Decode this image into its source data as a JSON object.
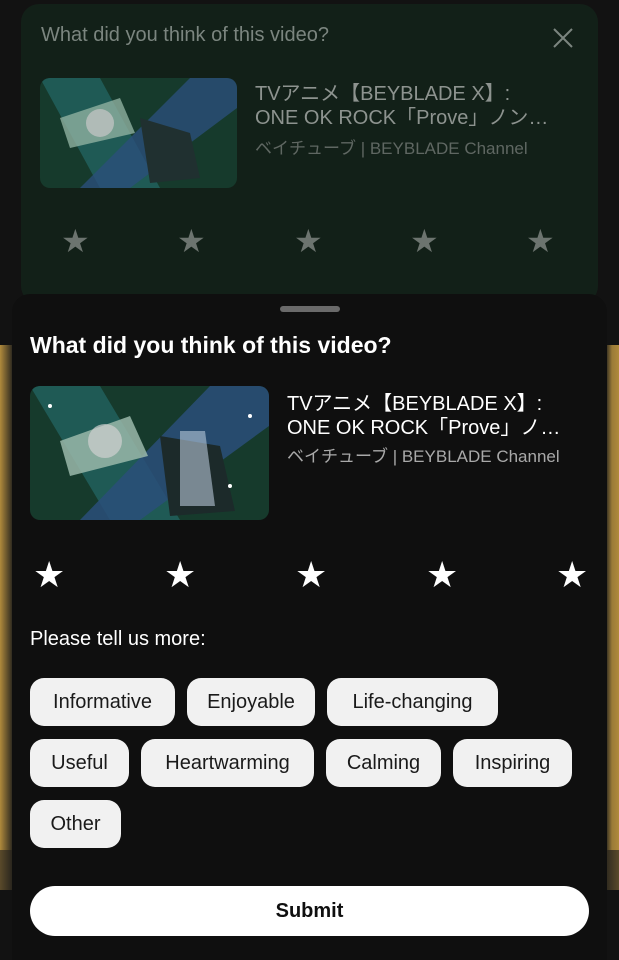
{
  "colors": {
    "background": "#121212",
    "sheet": "#0f0f0f",
    "chip_bg": "#f1f1f1",
    "text_primary": "#ffffff",
    "text_secondary": "#a9a9a9"
  },
  "back_card": {
    "title": "What did you think of this video?",
    "close_icon": "close-icon",
    "video_title_line1": "TVアニメ【BEYBLADE X】:",
    "video_title_line2": "ONE OK ROCK「Prove」ノン…",
    "channel": "ベイチューブ | BEYBLADE Channel"
  },
  "sheet": {
    "title": "What did you think of this video?",
    "video_title_line1": "TVアニメ【BEYBLADE X】:",
    "video_title_line2": "ONE OK ROCK「Prove」ノ…",
    "channel": "ベイチューブ | BEYBLADE Channel",
    "rating_max": 5,
    "rating_value": 0,
    "more_label": "Please tell us more:",
    "chips": [
      "Informative",
      "Enjoyable",
      "Life-changing",
      "Useful",
      "Heartwarming",
      "Calming",
      "Inspiring",
      "Other"
    ],
    "submit_label": "Submit"
  }
}
